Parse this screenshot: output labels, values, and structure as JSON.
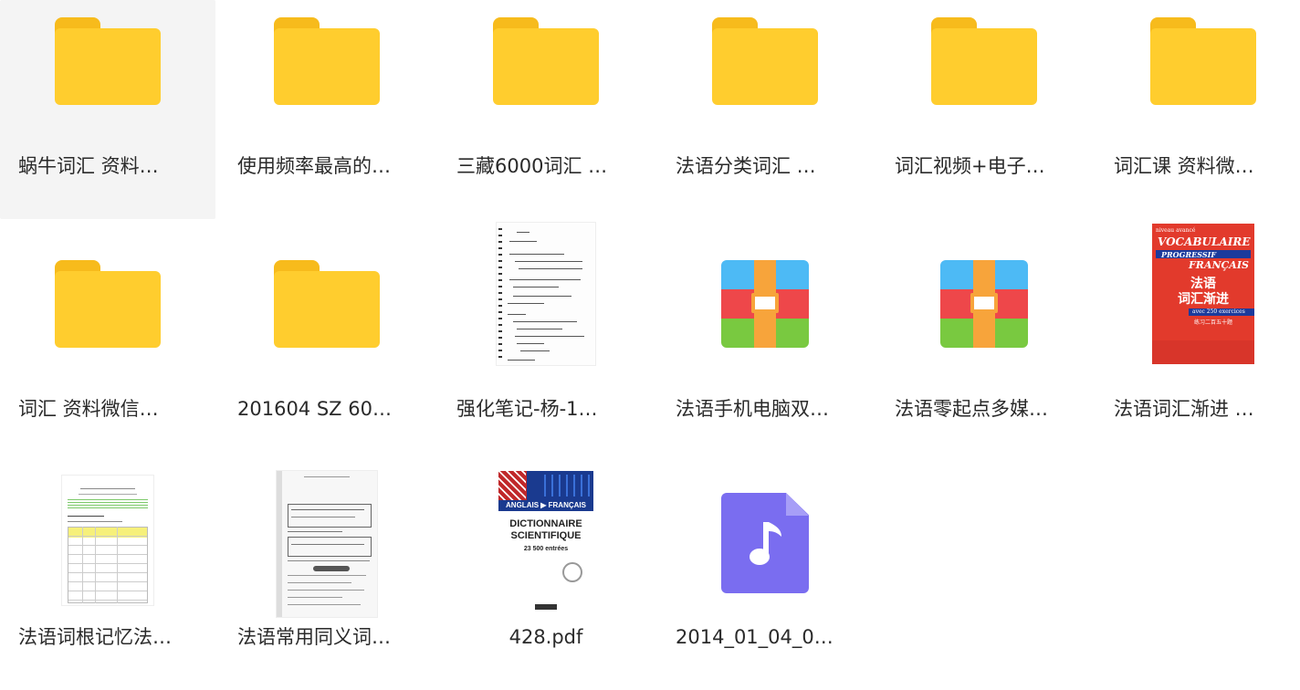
{
  "items": [
    {
      "name": "蜗牛词汇 资料…",
      "kind": "folder",
      "selected": true
    },
    {
      "name": "使用频率最高的…",
      "kind": "folder"
    },
    {
      "name": "三藏6000词汇 …",
      "kind": "folder"
    },
    {
      "name": "法语分类词汇 …",
      "kind": "folder"
    },
    {
      "name": "词汇视频+电子…",
      "kind": "folder"
    },
    {
      "name": "词汇课 资料微…",
      "kind": "folder"
    },
    {
      "name": "词汇 资料微信…",
      "kind": "folder"
    },
    {
      "name": "201604 SZ 60…",
      "kind": "folder"
    },
    {
      "name": "强化笔记-杨-1…",
      "kind": "notes-doc"
    },
    {
      "name": "法语手机电脑双…",
      "kind": "archive"
    },
    {
      "name": "法语零起点多媒…",
      "kind": "archive"
    },
    {
      "name": "法语词汇渐进 …",
      "kind": "book-cover"
    },
    {
      "name": "法语词根记忆法…",
      "kind": "table-doc"
    },
    {
      "name": "法语常用同义词…",
      "kind": "scan-doc"
    },
    {
      "name": "428.pdf",
      "kind": "pdf-cover"
    },
    {
      "name": "2014_01_04_0…",
      "kind": "audio"
    }
  ],
  "book_cover": {
    "title_line1": "VOCABULAIRE",
    "title_line2": "PROGRESSIF",
    "title_line3": "FRANÇAIS",
    "cn_title1": "法语",
    "cn_title2": "词汇渐进",
    "exercises": "avec 250 exercices",
    "cn_sub": "练习二百五十题"
  },
  "pdf_cover": {
    "band": "ANGLAIS ▶ FRANÇAIS",
    "title1": "DICTIONNAIRE",
    "title2": "SCIENTIFIQUE",
    "entries": "23 500 entrées"
  },
  "colors": {
    "folder": "#ffcd2e",
    "folder_tab": "#f7bb1c",
    "selection": "#f4f4f4",
    "audio": "#7a6df0"
  }
}
